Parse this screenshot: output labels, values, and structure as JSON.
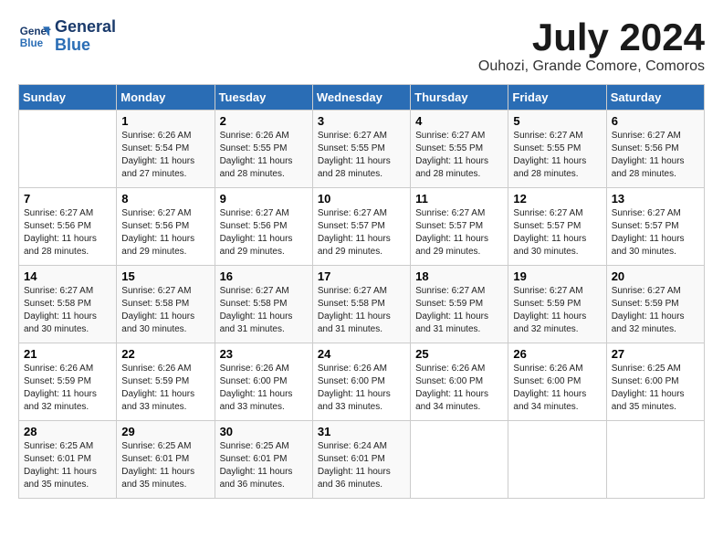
{
  "header": {
    "logo_line1": "General",
    "logo_line2": "Blue",
    "month": "July 2024",
    "location": "Ouhozi, Grande Comore, Comoros"
  },
  "weekdays": [
    "Sunday",
    "Monday",
    "Tuesday",
    "Wednesday",
    "Thursday",
    "Friday",
    "Saturday"
  ],
  "weeks": [
    [
      {
        "day": "",
        "sunrise": "",
        "sunset": "",
        "daylight": ""
      },
      {
        "day": "1",
        "sunrise": "Sunrise: 6:26 AM",
        "sunset": "Sunset: 5:54 PM",
        "daylight": "Daylight: 11 hours and 27 minutes."
      },
      {
        "day": "2",
        "sunrise": "Sunrise: 6:26 AM",
        "sunset": "Sunset: 5:55 PM",
        "daylight": "Daylight: 11 hours and 28 minutes."
      },
      {
        "day": "3",
        "sunrise": "Sunrise: 6:27 AM",
        "sunset": "Sunset: 5:55 PM",
        "daylight": "Daylight: 11 hours and 28 minutes."
      },
      {
        "day": "4",
        "sunrise": "Sunrise: 6:27 AM",
        "sunset": "Sunset: 5:55 PM",
        "daylight": "Daylight: 11 hours and 28 minutes."
      },
      {
        "day": "5",
        "sunrise": "Sunrise: 6:27 AM",
        "sunset": "Sunset: 5:55 PM",
        "daylight": "Daylight: 11 hours and 28 minutes."
      },
      {
        "day": "6",
        "sunrise": "Sunrise: 6:27 AM",
        "sunset": "Sunset: 5:56 PM",
        "daylight": "Daylight: 11 hours and 28 minutes."
      }
    ],
    [
      {
        "day": "7",
        "sunrise": "Sunrise: 6:27 AM",
        "sunset": "Sunset: 5:56 PM",
        "daylight": "Daylight: 11 hours and 28 minutes."
      },
      {
        "day": "8",
        "sunrise": "Sunrise: 6:27 AM",
        "sunset": "Sunset: 5:56 PM",
        "daylight": "Daylight: 11 hours and 29 minutes."
      },
      {
        "day": "9",
        "sunrise": "Sunrise: 6:27 AM",
        "sunset": "Sunset: 5:56 PM",
        "daylight": "Daylight: 11 hours and 29 minutes."
      },
      {
        "day": "10",
        "sunrise": "Sunrise: 6:27 AM",
        "sunset": "Sunset: 5:57 PM",
        "daylight": "Daylight: 11 hours and 29 minutes."
      },
      {
        "day": "11",
        "sunrise": "Sunrise: 6:27 AM",
        "sunset": "Sunset: 5:57 PM",
        "daylight": "Daylight: 11 hours and 29 minutes."
      },
      {
        "day": "12",
        "sunrise": "Sunrise: 6:27 AM",
        "sunset": "Sunset: 5:57 PM",
        "daylight": "Daylight: 11 hours and 30 minutes."
      },
      {
        "day": "13",
        "sunrise": "Sunrise: 6:27 AM",
        "sunset": "Sunset: 5:57 PM",
        "daylight": "Daylight: 11 hours and 30 minutes."
      }
    ],
    [
      {
        "day": "14",
        "sunrise": "Sunrise: 6:27 AM",
        "sunset": "Sunset: 5:58 PM",
        "daylight": "Daylight: 11 hours and 30 minutes."
      },
      {
        "day": "15",
        "sunrise": "Sunrise: 6:27 AM",
        "sunset": "Sunset: 5:58 PM",
        "daylight": "Daylight: 11 hours and 30 minutes."
      },
      {
        "day": "16",
        "sunrise": "Sunrise: 6:27 AM",
        "sunset": "Sunset: 5:58 PM",
        "daylight": "Daylight: 11 hours and 31 minutes."
      },
      {
        "day": "17",
        "sunrise": "Sunrise: 6:27 AM",
        "sunset": "Sunset: 5:58 PM",
        "daylight": "Daylight: 11 hours and 31 minutes."
      },
      {
        "day": "18",
        "sunrise": "Sunrise: 6:27 AM",
        "sunset": "Sunset: 5:59 PM",
        "daylight": "Daylight: 11 hours and 31 minutes."
      },
      {
        "day": "19",
        "sunrise": "Sunrise: 6:27 AM",
        "sunset": "Sunset: 5:59 PM",
        "daylight": "Daylight: 11 hours and 32 minutes."
      },
      {
        "day": "20",
        "sunrise": "Sunrise: 6:27 AM",
        "sunset": "Sunset: 5:59 PM",
        "daylight": "Daylight: 11 hours and 32 minutes."
      }
    ],
    [
      {
        "day": "21",
        "sunrise": "Sunrise: 6:26 AM",
        "sunset": "Sunset: 5:59 PM",
        "daylight": "Daylight: 11 hours and 32 minutes."
      },
      {
        "day": "22",
        "sunrise": "Sunrise: 6:26 AM",
        "sunset": "Sunset: 5:59 PM",
        "daylight": "Daylight: 11 hours and 33 minutes."
      },
      {
        "day": "23",
        "sunrise": "Sunrise: 6:26 AM",
        "sunset": "Sunset: 6:00 PM",
        "daylight": "Daylight: 11 hours and 33 minutes."
      },
      {
        "day": "24",
        "sunrise": "Sunrise: 6:26 AM",
        "sunset": "Sunset: 6:00 PM",
        "daylight": "Daylight: 11 hours and 33 minutes."
      },
      {
        "day": "25",
        "sunrise": "Sunrise: 6:26 AM",
        "sunset": "Sunset: 6:00 PM",
        "daylight": "Daylight: 11 hours and 34 minutes."
      },
      {
        "day": "26",
        "sunrise": "Sunrise: 6:26 AM",
        "sunset": "Sunset: 6:00 PM",
        "daylight": "Daylight: 11 hours and 34 minutes."
      },
      {
        "day": "27",
        "sunrise": "Sunrise: 6:25 AM",
        "sunset": "Sunset: 6:00 PM",
        "daylight": "Daylight: 11 hours and 35 minutes."
      }
    ],
    [
      {
        "day": "28",
        "sunrise": "Sunrise: 6:25 AM",
        "sunset": "Sunset: 6:01 PM",
        "daylight": "Daylight: 11 hours and 35 minutes."
      },
      {
        "day": "29",
        "sunrise": "Sunrise: 6:25 AM",
        "sunset": "Sunset: 6:01 PM",
        "daylight": "Daylight: 11 hours and 35 minutes."
      },
      {
        "day": "30",
        "sunrise": "Sunrise: 6:25 AM",
        "sunset": "Sunset: 6:01 PM",
        "daylight": "Daylight: 11 hours and 36 minutes."
      },
      {
        "day": "31",
        "sunrise": "Sunrise: 6:24 AM",
        "sunset": "Sunset: 6:01 PM",
        "daylight": "Daylight: 11 hours and 36 minutes."
      },
      {
        "day": "",
        "sunrise": "",
        "sunset": "",
        "daylight": ""
      },
      {
        "day": "",
        "sunrise": "",
        "sunset": "",
        "daylight": ""
      },
      {
        "day": "",
        "sunrise": "",
        "sunset": "",
        "daylight": ""
      }
    ]
  ]
}
